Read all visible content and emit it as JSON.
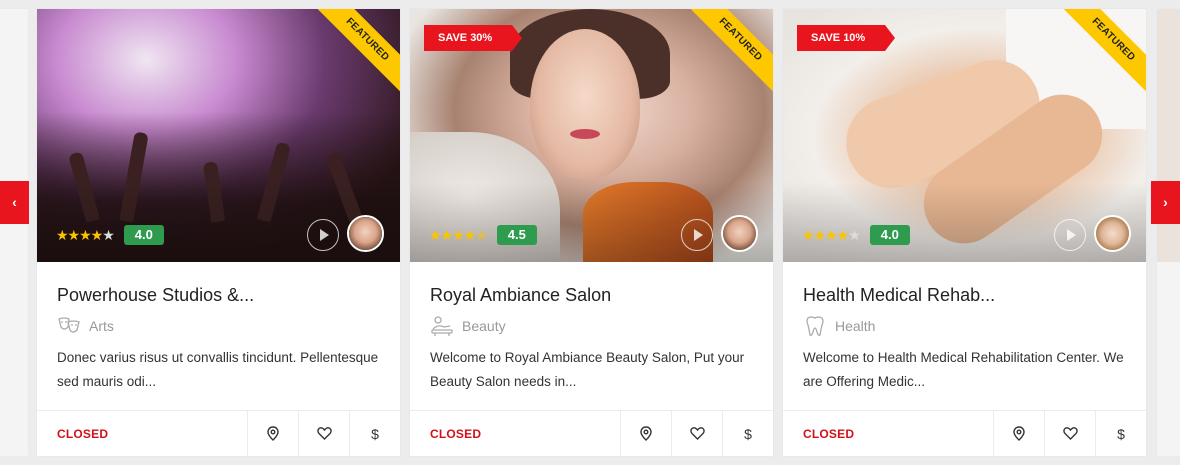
{
  "nav": {
    "prev_glyph": "‹",
    "next_glyph": "›"
  },
  "cards": [
    {
      "title": "Powerhouse Studios &...",
      "category": "Arts",
      "category_icon": "theater-masks-icon",
      "description": "Donec varius risus ut convallis tincidunt. Pellentesque sed mauris odi...",
      "rating": "4.0",
      "stars": "★★★★",
      "stars_empty": "★",
      "badge": "FEATURED",
      "status": "CLOSED",
      "price_glyph": "$"
    },
    {
      "title": "Royal Ambiance Salon",
      "category": "Beauty",
      "category_icon": "massage-icon",
      "description": "Welcome to Royal Ambiance Beauty Salon, Put your Beauty Salon needs in...",
      "rating": "4.5",
      "stars": "★★★★",
      "stars_empty": "★",
      "badge": "FEATURED",
      "save": "SAVE 30%",
      "status": "CLOSED",
      "price_glyph": "$"
    },
    {
      "title": "Health Medical Rehab...",
      "category": "Health",
      "category_icon": "tooth-icon",
      "description": "Welcome to Health Medical Rehabilitation Center. We are Offering Medic...",
      "rating": "4.0",
      "stars": "★★★★",
      "stars_empty": "★",
      "badge": "FEATURED",
      "save": "SAVE 10%",
      "status": "CLOSED",
      "price_glyph": "$"
    }
  ],
  "colors": {
    "accent": "#e8141e",
    "rating": "#2e9b4f",
    "ribbon": "#fdc800"
  }
}
